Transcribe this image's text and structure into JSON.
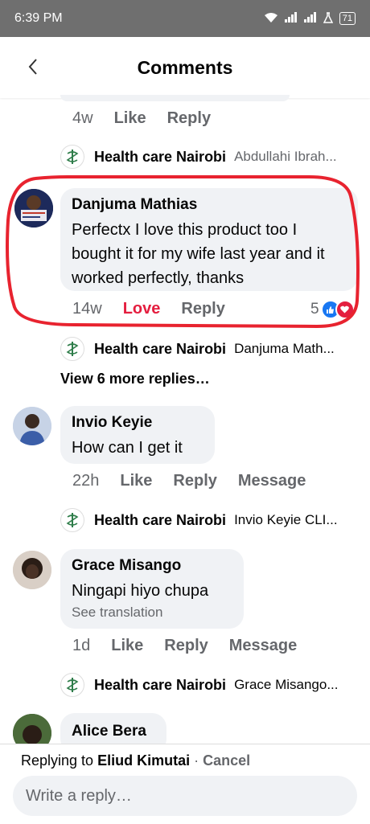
{
  "status_bar": {
    "time": "6:39 PM",
    "battery": "71"
  },
  "header": {
    "title": "Comments",
    "back": "‹"
  },
  "top_meta": {
    "time": "4w",
    "like": "Like",
    "reply": "Reply"
  },
  "reply_previews": [
    {
      "name": "Health care Nairobi",
      "text": "Abdullahi Ibrah..."
    },
    {
      "name": "Health care Nairobi",
      "text": "Danjuma Math..."
    },
    {
      "name": "Health care Nairobi",
      "text": "Invio Keyie CLI..."
    },
    {
      "name": "Health care Nairobi",
      "text": "Grace Misango..."
    }
  ],
  "comments": [
    {
      "name": "Danjuma Mathias",
      "text": "Perfectx I love this product too I bought it for my wife last year and it worked perfectly, thanks",
      "time": "14w",
      "like": "Love",
      "reply": "Reply",
      "reactions": "5"
    },
    {
      "name": "Invio Keyie",
      "text": "How can I get it",
      "time": "22h",
      "like": "Like",
      "reply": "Reply",
      "message": "Message"
    },
    {
      "name": "Grace Misango",
      "text": "Ningapi hiyo chupa",
      "translation": "See translation",
      "time": "1d",
      "like": "Like",
      "reply": "Reply",
      "message": "Message"
    },
    {
      "name": "Alice Bera"
    }
  ],
  "view_more": "View 6 more replies…",
  "composer": {
    "replying_prefix": "Replying to",
    "replying_to": "Eliud Kimutai",
    "separator": "·",
    "cancel": "Cancel",
    "placeholder": "Write a reply…"
  },
  "colors": {
    "love": "#e41e3f",
    "like_blue": "#1877f2",
    "annotation_red": "#e8232f",
    "muted": "#65676b"
  }
}
